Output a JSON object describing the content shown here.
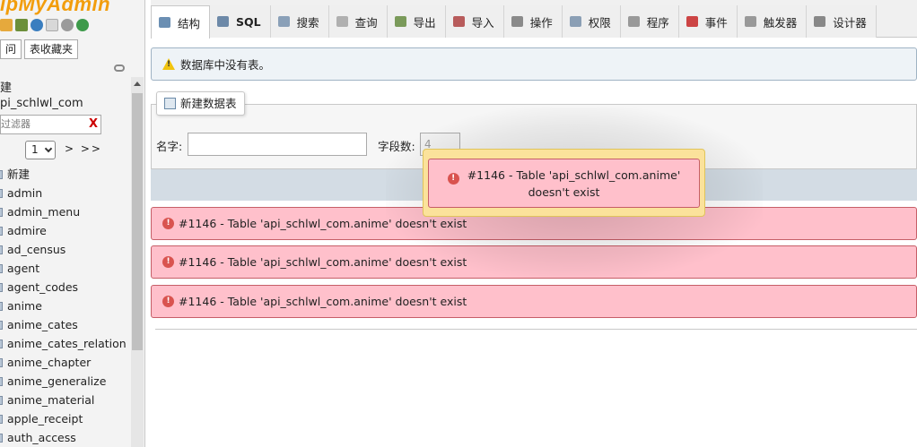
{
  "sidebar": {
    "logo": "ipMyAdmin",
    "icons": [
      "home-icon",
      "database-icon",
      "help-icon",
      "docs-icon",
      "settings-icon",
      "reload-icon"
    ],
    "tabs": [
      "问",
      "表收藏夹"
    ],
    "new_label": "建",
    "database": "pi_schlwl_com",
    "filter_placeholder": "过滤器",
    "filter_clear": "X",
    "page_value": "1",
    "page_next": "> >>",
    "tables": [
      "新建",
      "admin",
      "admin_menu",
      "admire",
      "ad_census",
      "agent",
      "agent_codes",
      "anime",
      "anime_cates",
      "anime_cates_relation",
      "anime_chapter",
      "anime_generalize",
      "anime_material",
      "apple_receipt",
      "auth_access"
    ]
  },
  "tabs": [
    {
      "key": "structure",
      "label": "结构",
      "icon": "structure-icon"
    },
    {
      "key": "sql",
      "label": "SQL",
      "icon": "sql-icon"
    },
    {
      "key": "search",
      "label": "搜索",
      "icon": "search-icon"
    },
    {
      "key": "query",
      "label": "查询",
      "icon": "query-icon"
    },
    {
      "key": "export",
      "label": "导出",
      "icon": "export-icon"
    },
    {
      "key": "import",
      "label": "导入",
      "icon": "import-icon"
    },
    {
      "key": "operations",
      "label": "操作",
      "icon": "wrench-icon"
    },
    {
      "key": "privileges",
      "label": "权限",
      "icon": "privileges-icon"
    },
    {
      "key": "routines",
      "label": "程序",
      "icon": "routines-icon"
    },
    {
      "key": "events",
      "label": "事件",
      "icon": "clock-icon"
    },
    {
      "key": "triggers",
      "label": "触发器",
      "icon": "trigger-icon"
    },
    {
      "key": "designer",
      "label": "设计器",
      "icon": "designer-icon"
    }
  ],
  "notice": "数据库中没有表。",
  "create_table": {
    "legend": "新建数据表",
    "name_label": "名字:",
    "columns_label": "字段数:",
    "columns_value": "4"
  },
  "errors": [
    "#1146 - Table 'api_schlwl_com.anime' doesn't exist",
    "#1146 - Table 'api_schlwl_com.anime' doesn't exist",
    "#1146 - Table 'api_schlwl_com.anime' doesn't exist"
  ],
  "popup": {
    "message": "#1146 - Table 'api_schlwl_com.anime' doesn't exist"
  },
  "colors": {
    "error_bg": "#ffc0cb",
    "error_border": "#c65e67",
    "notice_bg": "#eef3f7",
    "popup_bg": "#fbe29b",
    "logo": "#f29d0c"
  }
}
